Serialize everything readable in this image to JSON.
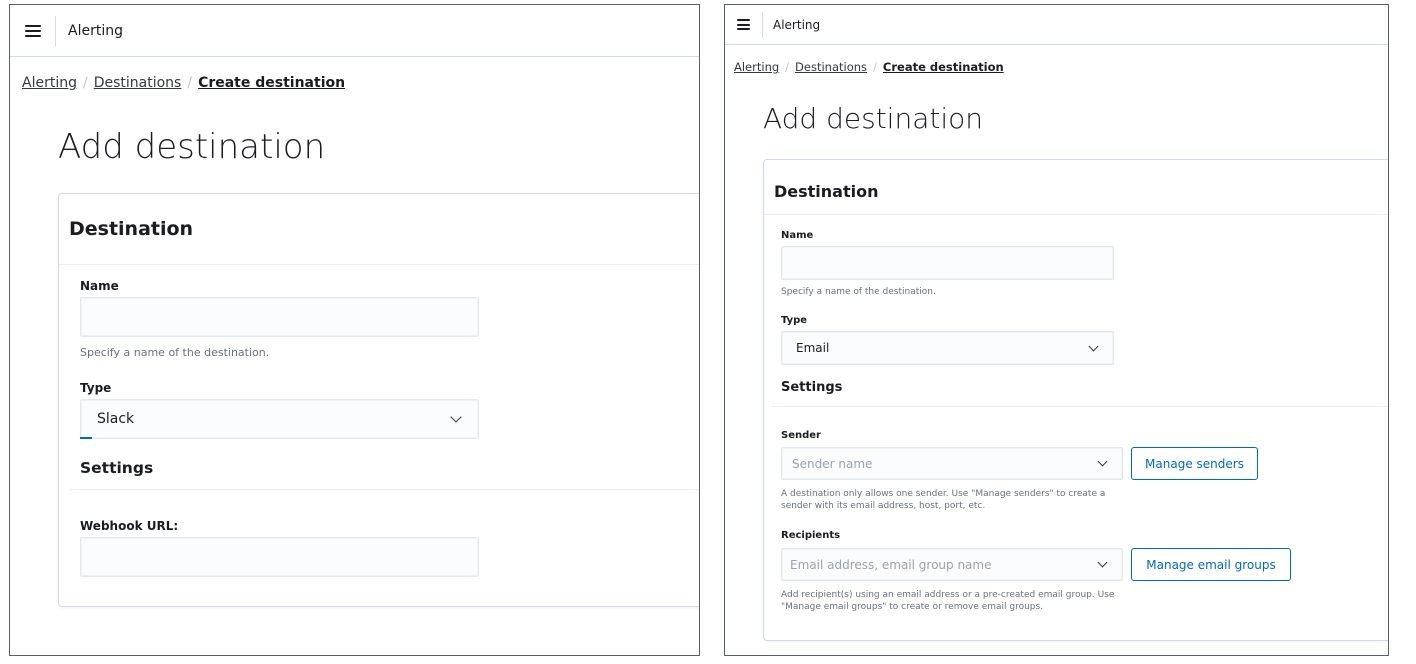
{
  "left": {
    "app_title": "Alerting",
    "breadcrumbs": [
      "Alerting",
      "Destinations",
      "Create destination"
    ],
    "page_title": "Add destination",
    "card_title": "Destination",
    "name_label": "Name",
    "name_value": "",
    "name_help": "Specify a name of the destination.",
    "type_label": "Type",
    "type_value": "Slack",
    "settings_title": "Settings",
    "webhook_label": "Webhook URL:",
    "webhook_value": ""
  },
  "right": {
    "app_title": "Alerting",
    "breadcrumbs": [
      "Alerting",
      "Destinations",
      "Create destination"
    ],
    "page_title": "Add destination",
    "card_title": "Destination",
    "name_label": "Name",
    "name_value": "",
    "name_help": "Specify a name of the destination.",
    "type_label": "Type",
    "type_value": "Email",
    "settings_title": "Settings",
    "sender_label": "Sender",
    "sender_placeholder": "Sender name",
    "manage_senders_label": "Manage senders",
    "sender_help_line1": "A destination only allows one sender. Use \"Manage senders\" to create a",
    "sender_help_line2": "sender with its email address, host, port, etc.",
    "recipients_label": "Recipients",
    "recipients_placeholder": "Email address, email group name",
    "manage_groups_label": "Manage email groups",
    "recipients_help_line1": "Add recipient(s) using an email address or a pre-created email group. Use",
    "recipients_help_line2": "\"Manage email groups\" to create or remove email groups."
  },
  "colors": {
    "accent": "#006bb8",
    "border": "#d3dae6",
    "text": "#1a1c21",
    "subdued": "#69707d",
    "panel_frame": "#5b5f66"
  },
  "icons": [
    "menu-icon",
    "chevron-down-icon"
  ]
}
